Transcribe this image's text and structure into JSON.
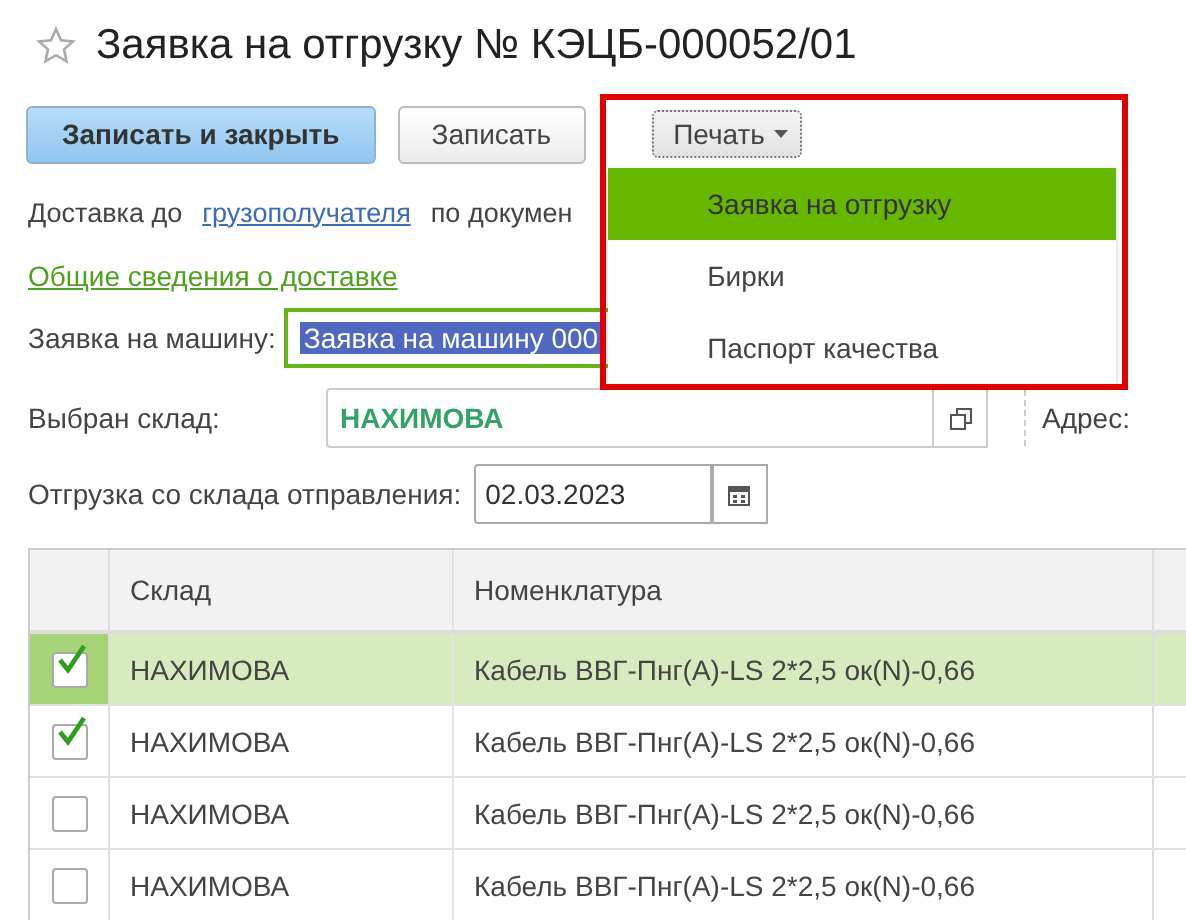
{
  "title": "Заявка на отгрузку № КЭЦБ-000052/01",
  "buttons": [
    {
      "label": "Записать и закрыть",
      "kind": "primary"
    },
    {
      "label": "Записать",
      "kind": "normal"
    }
  ],
  "print_button": {
    "label": "Печать",
    "expanded": true
  },
  "print_menu": [
    {
      "label": "Заявка на отгрузку",
      "selected": true
    },
    {
      "label": "Бирки",
      "selected": false
    },
    {
      "label": "Паспорт качества",
      "selected": false
    }
  ],
  "delivery": {
    "prefix": "Доставка до",
    "link": "грузополучателя",
    "suffix": "по докумен"
  },
  "general_link": "Общие сведения о доставке",
  "truck_request": {
    "label": "Заявка на машину:",
    "value": "Заявка на машину 000"
  },
  "warehouse": {
    "label": "Выбран склад:",
    "value": "НАХИМОВА"
  },
  "address": {
    "label": "Адрес:"
  },
  "shipment_date": {
    "label": "Отгрузка со склада отправления:",
    "value": "02.03.2023"
  },
  "table": {
    "columns": [
      "Склад",
      "Номенклатура"
    ],
    "rows": [
      {
        "checked": true,
        "selected": true,
        "cells": [
          "НАХИМОВА",
          "Кабель ВВГ-Пнг(А)-LS 2*2,5 ок(N)-0,66"
        ]
      },
      {
        "checked": true,
        "selected": false,
        "cells": [
          "НАХИМОВА",
          "Кабель ВВГ-Пнг(А)-LS 2*2,5 ок(N)-0,66"
        ]
      },
      {
        "checked": false,
        "selected": false,
        "cells": [
          "НАХИМОВА",
          "Кабель ВВГ-Пнг(А)-LS 2*2,5 ок(N)-0,66"
        ]
      },
      {
        "checked": false,
        "selected": false,
        "cells": [
          "НАХИМОВА",
          "Кабель ВВГ-Пнг(А)-LS 2*2,5 ок(N)-0,66"
        ]
      }
    ]
  }
}
